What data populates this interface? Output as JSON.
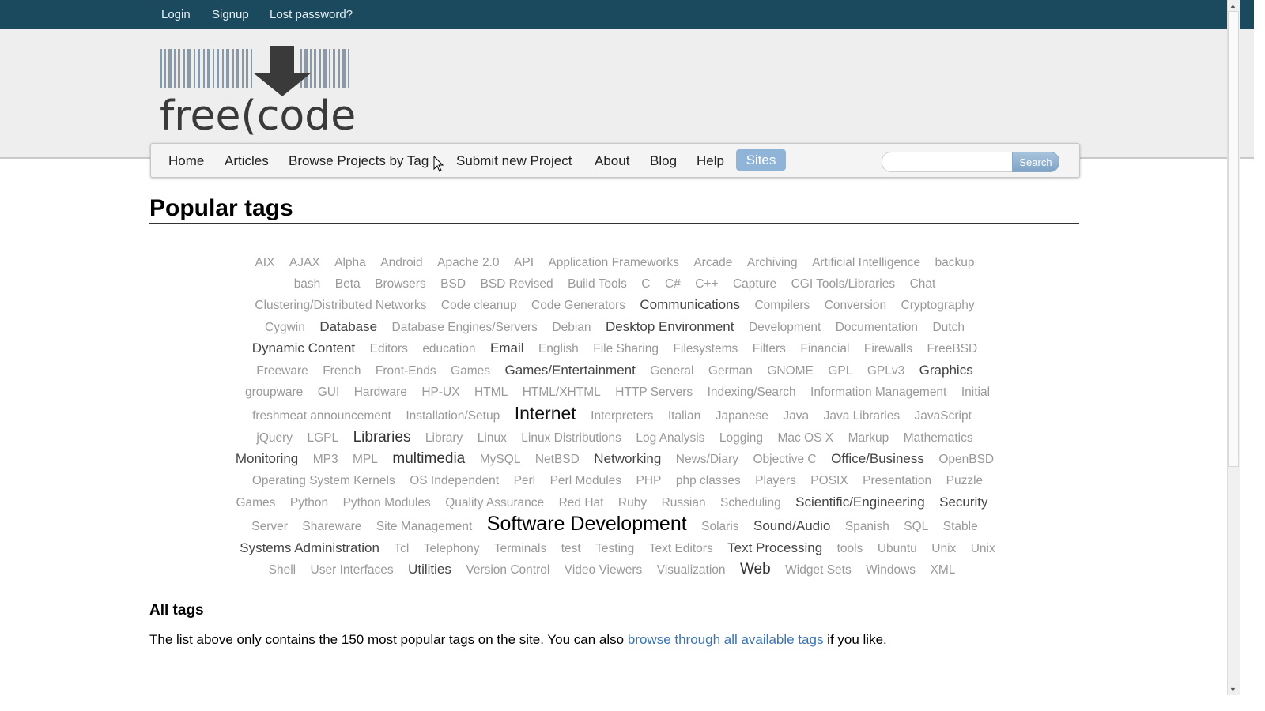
{
  "top_links": [
    "Login",
    "Signup",
    "Lost password?"
  ],
  "nav": {
    "items": [
      "Home",
      "Articles",
      "Browse Projects by Tag",
      "Submit new Project",
      "About",
      "Blog",
      "Help"
    ],
    "sites_label": "Sites",
    "search_button": "Search",
    "search_value": ""
  },
  "logo_text": "free(code):",
  "page_title": "Popular tags",
  "tags": [
    {
      "t": "AIX",
      "s": 1
    },
    {
      "t": "AJAX",
      "s": 1
    },
    {
      "t": "Alpha",
      "s": 1
    },
    {
      "t": "Android",
      "s": 1
    },
    {
      "t": "Apache 2.0",
      "s": 1
    },
    {
      "t": "API",
      "s": 1
    },
    {
      "t": "Application Frameworks",
      "s": 1
    },
    {
      "t": "Arcade",
      "s": 1
    },
    {
      "t": "Archiving",
      "s": 1
    },
    {
      "t": "Artificial Intelligence",
      "s": 1
    },
    {
      "t": "backup",
      "s": 1
    },
    {
      "t": "bash",
      "s": 1
    },
    {
      "t": "Beta",
      "s": 1
    },
    {
      "t": "Browsers",
      "s": 1
    },
    {
      "t": "BSD",
      "s": 1
    },
    {
      "t": "BSD Revised",
      "s": 1
    },
    {
      "t": "Build Tools",
      "s": 1
    },
    {
      "t": "C",
      "s": 1
    },
    {
      "t": "C#",
      "s": 1
    },
    {
      "t": "C++",
      "s": 1
    },
    {
      "t": "Capture",
      "s": 1
    },
    {
      "t": "CGI Tools/Libraries",
      "s": 1
    },
    {
      "t": "Chat",
      "s": 1
    },
    {
      "t": "Clustering/Distributed Networks",
      "s": 1
    },
    {
      "t": "Code cleanup",
      "s": 1
    },
    {
      "t": "Code Generators",
      "s": 1
    },
    {
      "t": "Communications",
      "s": 2
    },
    {
      "t": "Compilers",
      "s": 1
    },
    {
      "t": "Conversion",
      "s": 1
    },
    {
      "t": "Cryptography",
      "s": 1
    },
    {
      "t": "Cygwin",
      "s": 1
    },
    {
      "t": "Database",
      "s": 2
    },
    {
      "t": "Database Engines/Servers",
      "s": 1
    },
    {
      "t": "Debian",
      "s": 1
    },
    {
      "t": "Desktop Environment",
      "s": 2
    },
    {
      "t": "Development",
      "s": 1
    },
    {
      "t": "Documentation",
      "s": 1
    },
    {
      "t": "Dutch",
      "s": 1
    },
    {
      "t": "Dynamic Content",
      "s": 2
    },
    {
      "t": "Editors",
      "s": 1
    },
    {
      "t": "education",
      "s": 1
    },
    {
      "t": "Email",
      "s": 2
    },
    {
      "t": "English",
      "s": 1
    },
    {
      "t": "File Sharing",
      "s": 1
    },
    {
      "t": "Filesystems",
      "s": 1
    },
    {
      "t": "Filters",
      "s": 1
    },
    {
      "t": "Financial",
      "s": 1
    },
    {
      "t": "Firewalls",
      "s": 1
    },
    {
      "t": "FreeBSD",
      "s": 1
    },
    {
      "t": "Freeware",
      "s": 1
    },
    {
      "t": "French",
      "s": 1
    },
    {
      "t": "Front-Ends",
      "s": 1
    },
    {
      "t": "Games",
      "s": 1
    },
    {
      "t": "Games/Entertainment",
      "s": 2
    },
    {
      "t": "General",
      "s": 1
    },
    {
      "t": "German",
      "s": 1
    },
    {
      "t": "GNOME",
      "s": 1
    },
    {
      "t": "GPL",
      "s": 1
    },
    {
      "t": "GPLv3",
      "s": 1
    },
    {
      "t": "Graphics",
      "s": 2
    },
    {
      "t": "groupware",
      "s": 1
    },
    {
      "t": "GUI",
      "s": 1
    },
    {
      "t": "Hardware",
      "s": 1
    },
    {
      "t": "HP-UX",
      "s": 1
    },
    {
      "t": "HTML",
      "s": 1
    },
    {
      "t": "HTML/XHTML",
      "s": 1
    },
    {
      "t": "HTTP Servers",
      "s": 1
    },
    {
      "t": "Indexing/Search",
      "s": 1
    },
    {
      "t": "Information Management",
      "s": 1
    },
    {
      "t": "Initial freshmeat announcement",
      "s": 1
    },
    {
      "t": "Installation/Setup",
      "s": 1
    },
    {
      "t": "Internet",
      "s": 4
    },
    {
      "t": "Interpreters",
      "s": 1
    },
    {
      "t": "Italian",
      "s": 1
    },
    {
      "t": "Japanese",
      "s": 1
    },
    {
      "t": "Java",
      "s": 1
    },
    {
      "t": "Java Libraries",
      "s": 1
    },
    {
      "t": "JavaScript",
      "s": 1
    },
    {
      "t": "jQuery",
      "s": 1
    },
    {
      "t": "LGPL",
      "s": 1
    },
    {
      "t": "Libraries",
      "s": 3
    },
    {
      "t": "Library",
      "s": 1
    },
    {
      "t": "Linux",
      "s": 1
    },
    {
      "t": "Linux Distributions",
      "s": 1
    },
    {
      "t": "Log Analysis",
      "s": 1
    },
    {
      "t": "Logging",
      "s": 1
    },
    {
      "t": "Mac OS X",
      "s": 1
    },
    {
      "t": "Markup",
      "s": 1
    },
    {
      "t": "Mathematics",
      "s": 1
    },
    {
      "t": "Monitoring",
      "s": 2
    },
    {
      "t": "MP3",
      "s": 1
    },
    {
      "t": "MPL",
      "s": 1
    },
    {
      "t": "multimedia",
      "s": 3
    },
    {
      "t": "MySQL",
      "s": 1
    },
    {
      "t": "NetBSD",
      "s": 1
    },
    {
      "t": "Networking",
      "s": 2
    },
    {
      "t": "News/Diary",
      "s": 1
    },
    {
      "t": "Objective C",
      "s": 1
    },
    {
      "t": "Office/Business",
      "s": 2
    },
    {
      "t": "OpenBSD",
      "s": 1
    },
    {
      "t": "Operating System Kernels",
      "s": 1
    },
    {
      "t": "OS Independent",
      "s": 1
    },
    {
      "t": "Perl",
      "s": 1
    },
    {
      "t": "Perl Modules",
      "s": 1
    },
    {
      "t": "PHP",
      "s": 1
    },
    {
      "t": "php classes",
      "s": 1
    },
    {
      "t": "Players",
      "s": 1
    },
    {
      "t": "POSIX",
      "s": 1
    },
    {
      "t": "Presentation",
      "s": 1
    },
    {
      "t": "Puzzle Games",
      "s": 1
    },
    {
      "t": "Python",
      "s": 1
    },
    {
      "t": "Python Modules",
      "s": 1
    },
    {
      "t": "Quality Assurance",
      "s": 1
    },
    {
      "t": "Red Hat",
      "s": 1
    },
    {
      "t": "Ruby",
      "s": 1
    },
    {
      "t": "Russian",
      "s": 1
    },
    {
      "t": "Scheduling",
      "s": 1
    },
    {
      "t": "Scientific/Engineering",
      "s": 2
    },
    {
      "t": "Security",
      "s": 2
    },
    {
      "t": "Server",
      "s": 1
    },
    {
      "t": "Shareware",
      "s": 1
    },
    {
      "t": "Site Management",
      "s": 1
    },
    {
      "t": "Software Development",
      "s": 5
    },
    {
      "t": "Solaris",
      "s": 1
    },
    {
      "t": "Sound/Audio",
      "s": 2
    },
    {
      "t": "Spanish",
      "s": 1
    },
    {
      "t": "SQL",
      "s": 1
    },
    {
      "t": "Stable",
      "s": 1
    },
    {
      "t": "Systems Administration",
      "s": 2
    },
    {
      "t": "Tcl",
      "s": 1
    },
    {
      "t": "Telephony",
      "s": 1
    },
    {
      "t": "Terminals",
      "s": 1
    },
    {
      "t": "test",
      "s": 1
    },
    {
      "t": "Testing",
      "s": 1
    },
    {
      "t": "Text Editors",
      "s": 1
    },
    {
      "t": "Text Processing",
      "s": 2
    },
    {
      "t": "tools",
      "s": 1
    },
    {
      "t": "Ubuntu",
      "s": 1
    },
    {
      "t": "Unix",
      "s": 1
    },
    {
      "t": "Unix Shell",
      "s": 1
    },
    {
      "t": "User Interfaces",
      "s": 1
    },
    {
      "t": "Utilities",
      "s": 2
    },
    {
      "t": "Version Control",
      "s": 1
    },
    {
      "t": "Video Viewers",
      "s": 1
    },
    {
      "t": "Visualization",
      "s": 1
    },
    {
      "t": "Web",
      "s": 3
    },
    {
      "t": "Widget Sets",
      "s": 1
    },
    {
      "t": "Windows",
      "s": 1
    },
    {
      "t": "XML",
      "s": 1
    }
  ],
  "all_tags": {
    "heading": "All tags",
    "text_before": "The list above only contains the 150 most popular tags on the site. You can also ",
    "link_text": "browse through all available tags",
    "text_after": " if you like."
  },
  "colors": {
    "topbar": "#1b4a5e",
    "header_band": "#eeeeee",
    "sites_button": "#8fb4d8",
    "link": "#3a74b4",
    "tag_default": "#999999"
  }
}
